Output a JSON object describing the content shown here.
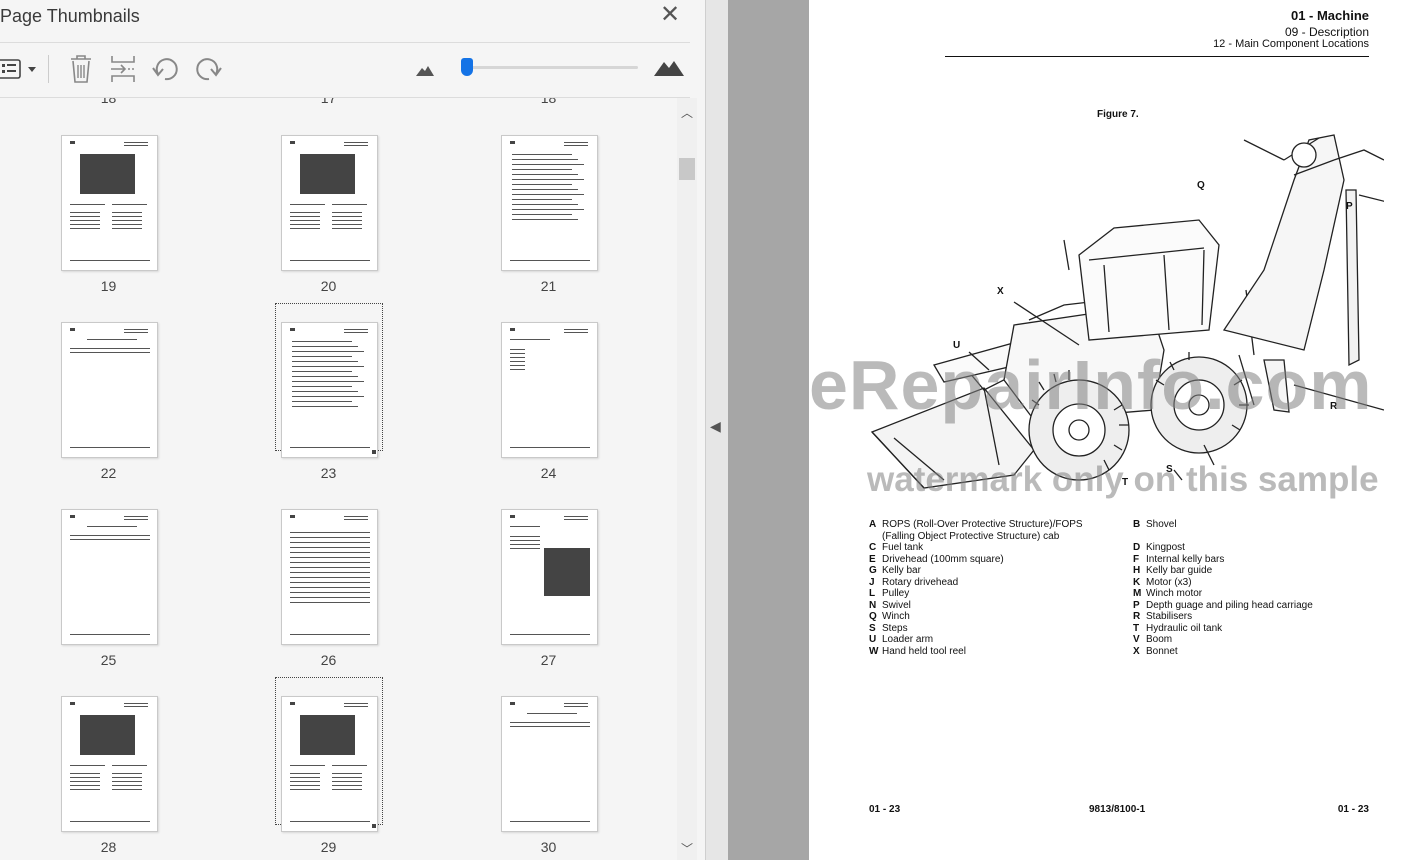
{
  "panel": {
    "title": "Page Thumbnails",
    "close_icon": "close-icon",
    "toolbar": {
      "options_icon": "thumbnail-options-icon",
      "delete_icon": "trash-icon",
      "insert_icon": "insert-pages-icon",
      "rotate_ccw_icon": "rotate-counterclockwise-icon",
      "rotate_cw_icon": "rotate-clockwise-icon",
      "zoom_out_icon": "small-mountain-icon",
      "zoom_in_icon": "large-mountain-icon",
      "zoom_level": 0.03
    },
    "partial_row_labels": [
      "18",
      "17",
      "18"
    ],
    "thumbnails": [
      {
        "page": "19"
      },
      {
        "page": "20"
      },
      {
        "page": "21"
      },
      {
        "page": "22"
      },
      {
        "page": "23",
        "selected": true
      },
      {
        "page": "24"
      },
      {
        "page": "25"
      },
      {
        "page": "26"
      },
      {
        "page": "27"
      },
      {
        "page": "28"
      },
      {
        "page": "29",
        "selected": true
      },
      {
        "page": "30"
      }
    ]
  },
  "document": {
    "header": {
      "section": "01 - Machine",
      "subsection": "09 - Description",
      "topic": "12 - Main Component Locations"
    },
    "figure_label": "Figure 7.",
    "callouts": {
      "Q": "Q",
      "P": "P",
      "X": "X",
      "U": "U",
      "R": "R",
      "S": "S",
      "T": "T"
    },
    "legend_left": [
      {
        "key": "A",
        "text": "ROPS (Roll-Over Protective Structure)/FOPS"
      },
      {
        "key": "",
        "text": "(Falling Object Protective Structure) cab"
      },
      {
        "key": "C",
        "text": "Fuel tank"
      },
      {
        "key": "E",
        "text": "Drivehead (100mm square)"
      },
      {
        "key": "G",
        "text": "Kelly bar"
      },
      {
        "key": "J",
        "text": "Rotary drivehead"
      },
      {
        "key": "L",
        "text": "Pulley"
      },
      {
        "key": "N",
        "text": "Swivel"
      },
      {
        "key": "Q",
        "text": "Winch"
      },
      {
        "key": "S",
        "text": "Steps"
      },
      {
        "key": "U",
        "text": "Loader arm"
      },
      {
        "key": "W",
        "text": "Hand held tool reel"
      }
    ],
    "legend_right": [
      {
        "key": "B",
        "text": "Shovel"
      },
      {
        "key": "",
        "text": ""
      },
      {
        "key": "D",
        "text": "Kingpost"
      },
      {
        "key": "F",
        "text": "Internal kelly bars"
      },
      {
        "key": "H",
        "text": "Kelly bar guide"
      },
      {
        "key": "K",
        "text": "Motor (x3)"
      },
      {
        "key": "M",
        "text": "Winch motor"
      },
      {
        "key": "P",
        "text": "Depth guage and piling head carriage"
      },
      {
        "key": "R",
        "text": "Stabilisers"
      },
      {
        "key": "T",
        "text": "Hydraulic oil tank"
      },
      {
        "key": "V",
        "text": "Boom"
      },
      {
        "key": "X",
        "text": "Bonnet"
      }
    ],
    "watermark_main": "eRepairInfo.com",
    "watermark_sub": "watermark only on this sample",
    "footer": {
      "left": "01 - 23",
      "center": "9813/8100-1",
      "right": "01 - 23"
    }
  }
}
